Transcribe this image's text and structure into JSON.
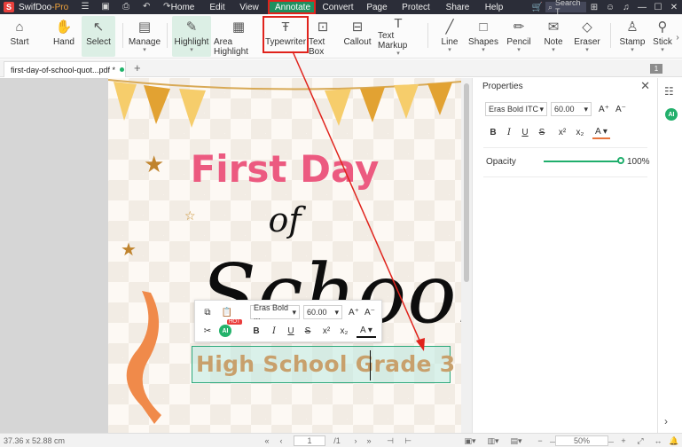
{
  "app": {
    "name": "SwifDoo",
    "edition": "-Pro",
    "logo": "S"
  },
  "menu": [
    "Home",
    "Edit",
    "View",
    "Annotate",
    "Convert",
    "Page",
    "Protect",
    "Share",
    "Help"
  ],
  "search_placeholder": "Search T",
  "toolbar": {
    "start": "Start",
    "hand": "Hand",
    "select": "Select",
    "manage": "Manage",
    "highlight": "Highlight",
    "area_highlight": "Area Highlight",
    "typewriter": "Typewriter",
    "text_box": "Text Box",
    "callout": "Callout",
    "text_markup": "Text Markup",
    "line": "Line",
    "shapes": "Shapes",
    "pencil": "Pencil",
    "note": "Note",
    "eraser": "Eraser",
    "stamp": "Stamp",
    "stick": "Stick"
  },
  "tab": {
    "filename": "first-day-of-school-quot...pdf *",
    "page_badge": "1"
  },
  "document": {
    "line1": "First Day",
    "line2": "of",
    "line3": "School",
    "edited_text": "High School Grade 3"
  },
  "mini_toolbar": {
    "font": "Eras Bold ...",
    "size": "60.00",
    "ai": "AI",
    "hot": "HOT"
  },
  "properties": {
    "title": "Properties",
    "font": "Eras Bold ITC",
    "size": "60.00",
    "opacity_label": "Opacity",
    "opacity_value": "100%",
    "opacity_level": 1.0
  },
  "status": {
    "dimensions": "37.36 x 52.88 cm",
    "current_page": "1",
    "total_pages": "/1",
    "zoom": "50%"
  },
  "colors": {
    "accent": "#1f8f5f",
    "highlight_red": "#e0231c",
    "pink_title": "#ec5a80"
  }
}
